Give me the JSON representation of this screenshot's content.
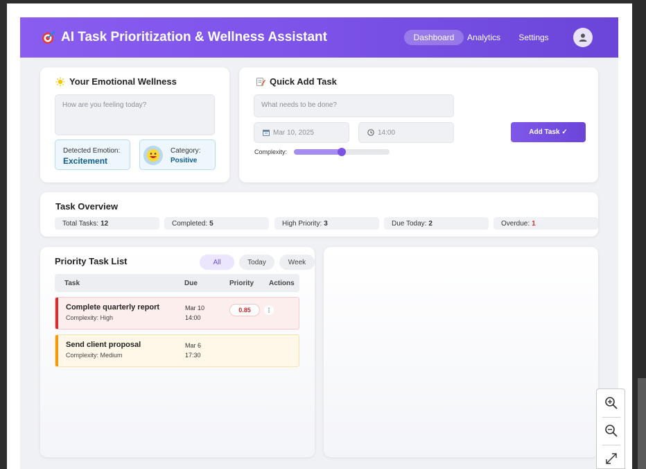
{
  "header": {
    "title": "AI Task Prioritization & Wellness Assistant",
    "logo_icon": "target-icon",
    "nav": [
      {
        "label": "Dashboard",
        "active": true
      },
      {
        "label": "Analytics",
        "active": false
      },
      {
        "label": "Settings",
        "active": false
      }
    ],
    "avatar_icon": "user-icon"
  },
  "wellness": {
    "title": "Your Emotional Wellness",
    "icon": "sun-icon",
    "input_placeholder": "How are you feeling today?",
    "emotion_label": "Detected Emotion:",
    "emotion_value": "Excitement",
    "category_label": "Category:",
    "category_value": "Positive",
    "category_icon": "happy-face-icon"
  },
  "quick_add": {
    "title": "Quick Add Task",
    "icon": "memo-icon",
    "task_placeholder": "What needs to be done?",
    "date_value": "Mar 10, 2025",
    "time_value": "14:00",
    "complexity_label": "Complexity:",
    "complexity_level": 0.5,
    "add_button": "Add Task ✓"
  },
  "overview": {
    "title": "Task Overview",
    "stats": [
      {
        "label": "Total Tasks:",
        "value": "12",
        "color": "#222222"
      },
      {
        "label": "Completed:",
        "value": "5",
        "color": "#222222"
      },
      {
        "label": "High Priority:",
        "value": "3",
        "color": "#222222"
      },
      {
        "label": "Due Today:",
        "value": "2",
        "color": "#222222"
      },
      {
        "label": "Overdue:",
        "value": "1",
        "color": "#d32f2f"
      }
    ]
  },
  "task_list": {
    "title": "Priority Task List",
    "filters": [
      {
        "label": "All",
        "active": true
      },
      {
        "label": "Today",
        "active": false
      },
      {
        "label": "Week",
        "active": false
      }
    ],
    "columns": [
      "Task",
      "Due",
      "Priority",
      "Actions"
    ],
    "tasks": [
      {
        "name": "Complete quarterly report",
        "complexity": "Complexity: High",
        "due_date": "Mar 10",
        "due_time": "14:00",
        "priority": "0.85",
        "accent": "#d32f2f",
        "bg": "#fdeeee",
        "border": "#f6caca"
      },
      {
        "name": "Send client proposal",
        "complexity": "Complexity: Medium",
        "due_date": "Mar 6",
        "due_time": "17:30",
        "priority": "",
        "accent": "#f29a0d",
        "bg": "#fff8e8",
        "border": "#f8e2b0"
      }
    ]
  },
  "colors": {
    "accent": "#7c52e8",
    "header_gradient_start": "#8a5df0",
    "header_gradient_end": "#6a45d8"
  }
}
